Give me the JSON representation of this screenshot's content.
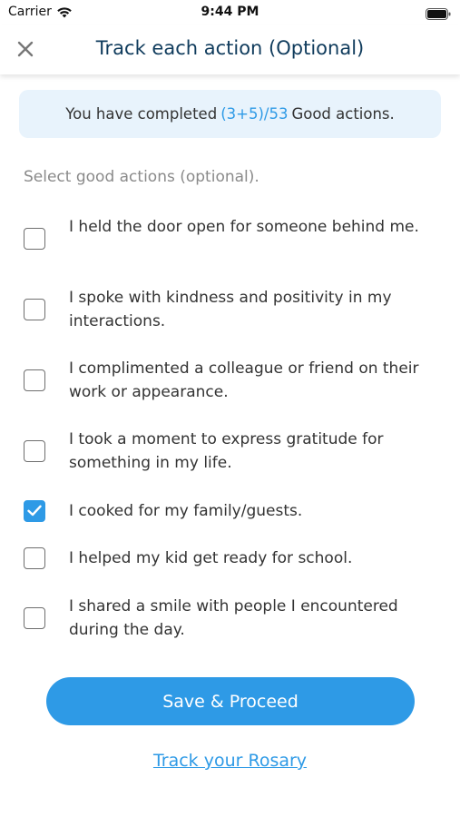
{
  "status_bar": {
    "carrier": "Carrier",
    "time": "9:44 PM",
    "wifi_icon": "wifi-icon",
    "battery_icon": "battery-icon"
  },
  "nav": {
    "title": "Track each action (Optional)",
    "close_icon": "close-icon"
  },
  "progress": {
    "prefix": "You have completed",
    "count": "(3+5)/53",
    "suffix": "Good actions."
  },
  "select_hint": "Select good actions (optional).",
  "actions": [
    {
      "label": "I held the door open for someone behind me.",
      "checked": false
    },
    {
      "label": "I spoke with kindness and positivity in my interactions.",
      "checked": false
    },
    {
      "label": "I complimented a colleague or friend on their work or appearance.",
      "checked": false
    },
    {
      "label": "I took a moment to express gratitude for something in my life.",
      "checked": false
    },
    {
      "label": "I cooked for my family/guests.",
      "checked": true
    },
    {
      "label": "I helped my kid get ready for school.",
      "checked": false
    },
    {
      "label": "I shared a smile with people I encountered during the day.",
      "checked": false
    }
  ],
  "buttons": {
    "save_label": "Save & Proceed",
    "rosary_link": "Track your Rosary"
  },
  "colors": {
    "accent": "#2e9ae6",
    "title": "#0f3b5c",
    "progress_bg": "#e8f3fc"
  }
}
